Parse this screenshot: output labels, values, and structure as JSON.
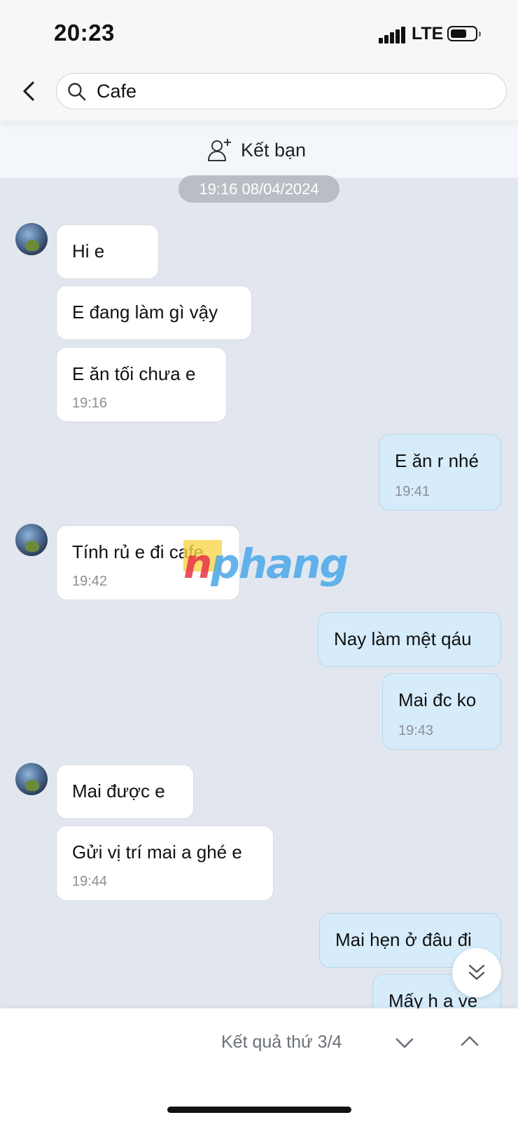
{
  "status_bar": {
    "time": "20:23",
    "network": "LTE"
  },
  "search": {
    "query": "Cafe"
  },
  "friend_bar": {
    "label": "Kết bạn"
  },
  "date_separator": "19:16 08/04/2024",
  "messages": [
    {
      "text": "Hi e",
      "time": ""
    },
    {
      "text": "E đang làm gì vậy",
      "time": ""
    },
    {
      "text": "E ăn tối chưa e",
      "time": "19:16"
    },
    {
      "text": "E ăn r nhé",
      "time": "19:41"
    },
    {
      "text": "Tính rủ e đi cafe",
      "time": "19:42"
    },
    {
      "text": "Nay làm mệt qáu",
      "time": ""
    },
    {
      "text": "Mai đc ko",
      "time": "19:43"
    },
    {
      "text": "Mai được e",
      "time": ""
    },
    {
      "text": "Gửi vị trí mai a ghé e",
      "time": "19:44"
    },
    {
      "text": "Mai hẹn ở đâu đi",
      "time": ""
    },
    {
      "text": "Mấy h a ve",
      "time": ""
    }
  ],
  "search_result": {
    "label": "Kết quả thứ 3/4"
  },
  "watermark": "nphang"
}
